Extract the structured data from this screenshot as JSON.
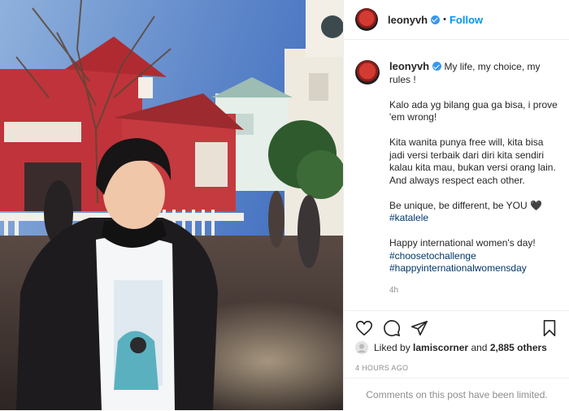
{
  "header": {
    "username": "leonyvh",
    "separator": "•",
    "follow_label": "Follow"
  },
  "caption": {
    "username": "leonyvh",
    "text": "My life, my choice, my rules !\n\nKalo ada yg bilang gua ga bisa, i prove 'em wrong!\n\nKita wanita punya free will, kita bisa jadi versi terbaik dari diri kita sendiri kalau kita mau, bukan versi orang lain.\nAnd always respect each other.\n\nBe unique, be different, be YOU 🖤",
    "hashtag_1": "#katalele",
    "text_2": "Happy international women's day!",
    "hashtag_2": "#choosetochallenge",
    "hashtag_3": "#happyinternationalwomensday",
    "time": "4h"
  },
  "actions": {
    "like_icon": "heart-icon",
    "comment_icon": "comment-icon",
    "share_icon": "paper-plane-icon",
    "save_icon": "bookmark-icon"
  },
  "likes": {
    "prefix": "Liked by ",
    "user": "lamiscorner",
    "middle": " and ",
    "others": "2,885 others"
  },
  "timestamp": "4 HOURS AGO",
  "comments_notice": "Comments on this post have been limited.",
  "colors": {
    "link_blue": "#0095f6",
    "hashtag_blue": "#00376b",
    "muted_gray": "#8e8e8e",
    "verified_blue": "#3897f0"
  }
}
